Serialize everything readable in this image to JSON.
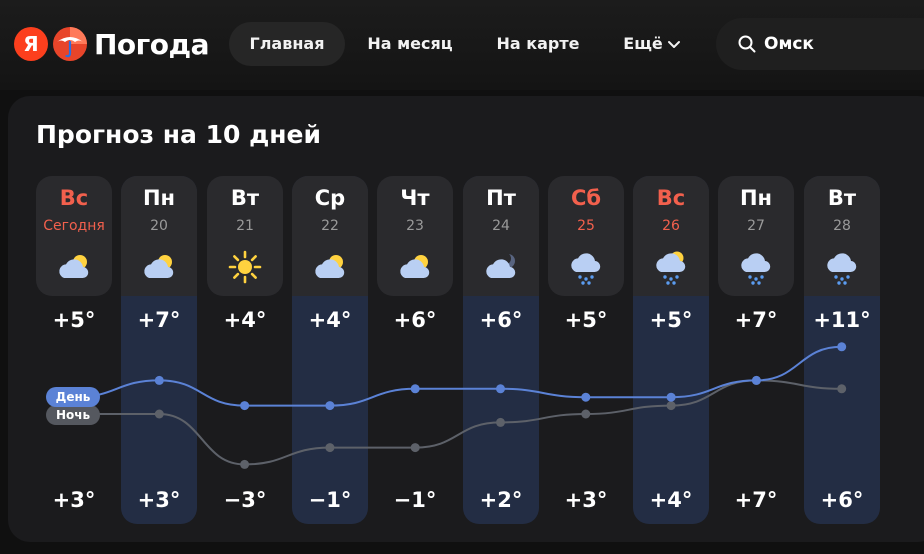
{
  "header": {
    "logo_letter": "Я",
    "logo_text": "Погода",
    "nav": [
      {
        "label": "Главная",
        "active": true
      },
      {
        "label": "На месяц",
        "active": false
      },
      {
        "label": "На карте",
        "active": false
      },
      {
        "label": "Ещё",
        "active": false
      }
    ],
    "search": {
      "value": "Омск",
      "icon": "search-icon"
    }
  },
  "forecast": {
    "title": "Прогноз на 10 дней",
    "series_labels": {
      "day": "День",
      "night": "Ночь"
    },
    "colors": {
      "day_line": "#5b82d6",
      "night_line": "#5d6169",
      "weekend": "#f2604d",
      "highlight": "#232d44"
    },
    "days": [
      {
        "weekday": "Вс",
        "date": "Сегодня",
        "weekend": true,
        "icon": "partly-cloudy-icon",
        "temp_day": "+5°",
        "temp_night": "+3°",
        "day_value": 5,
        "night_value": 3
      },
      {
        "weekday": "Пн",
        "date": "20",
        "weekend": false,
        "icon": "partly-cloudy-icon",
        "temp_day": "+7°",
        "temp_night": "+3°",
        "day_value": 7,
        "night_value": 3
      },
      {
        "weekday": "Вт",
        "date": "21",
        "weekend": false,
        "icon": "sun-icon",
        "temp_day": "+4°",
        "temp_night": "−3°",
        "day_value": 4,
        "night_value": -3
      },
      {
        "weekday": "Ср",
        "date": "22",
        "weekend": false,
        "icon": "partly-cloudy-icon",
        "temp_day": "+4°",
        "temp_night": "−1°",
        "day_value": 4,
        "night_value": -1
      },
      {
        "weekday": "Чт",
        "date": "23",
        "weekend": false,
        "icon": "partly-cloudy-icon",
        "temp_day": "+6°",
        "temp_night": "−1°",
        "day_value": 6,
        "night_value": -1
      },
      {
        "weekday": "Пт",
        "date": "24",
        "weekend": false,
        "icon": "cloudy-moon-icon",
        "temp_day": "+6°",
        "temp_night": "+2°",
        "day_value": 6,
        "night_value": 2
      },
      {
        "weekday": "Сб",
        "date": "25",
        "weekend": true,
        "icon": "cloud-rain-icon",
        "temp_day": "+5°",
        "temp_night": "+3°",
        "day_value": 5,
        "night_value": 3
      },
      {
        "weekday": "Вс",
        "date": "26",
        "weekend": true,
        "icon": "sun-cloud-rain-icon",
        "temp_day": "+5°",
        "temp_night": "+4°",
        "day_value": 5,
        "night_value": 4
      },
      {
        "weekday": "Пн",
        "date": "27",
        "weekend": false,
        "icon": "cloud-rain-icon",
        "temp_day": "+7°",
        "temp_night": "+7°",
        "day_value": 7,
        "night_value": 7
      },
      {
        "weekday": "Вт",
        "date": "28",
        "weekend": false,
        "icon": "cloud-rain-icon",
        "temp_day": "+11°",
        "temp_night": "+6°",
        "day_value": 11,
        "night_value": 6
      }
    ]
  }
}
